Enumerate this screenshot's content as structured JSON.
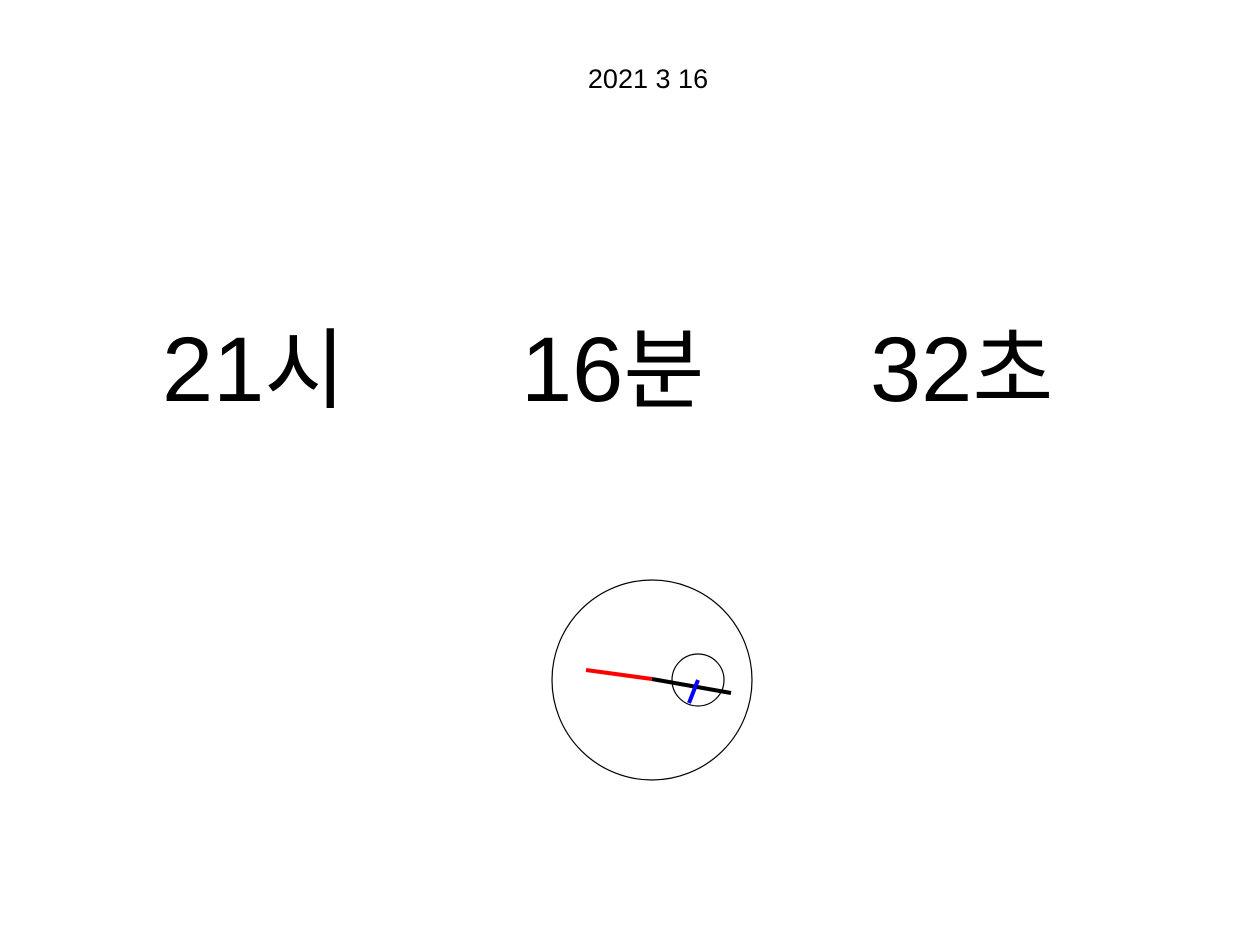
{
  "date": {
    "year": "2021",
    "month": "3",
    "day": "16"
  },
  "time": {
    "hours": "21",
    "hours_unit": "시",
    "minutes": "16",
    "minutes_unit": "분",
    "seconds": "32",
    "seconds_unit": "초"
  },
  "clock": {
    "hour_value": 21,
    "minute_value": 16,
    "second_value": 32,
    "colors": {
      "outline": "#000000",
      "hand_red": "#ff0000",
      "hand_black": "#000000",
      "hand_blue": "#0000ff"
    }
  }
}
